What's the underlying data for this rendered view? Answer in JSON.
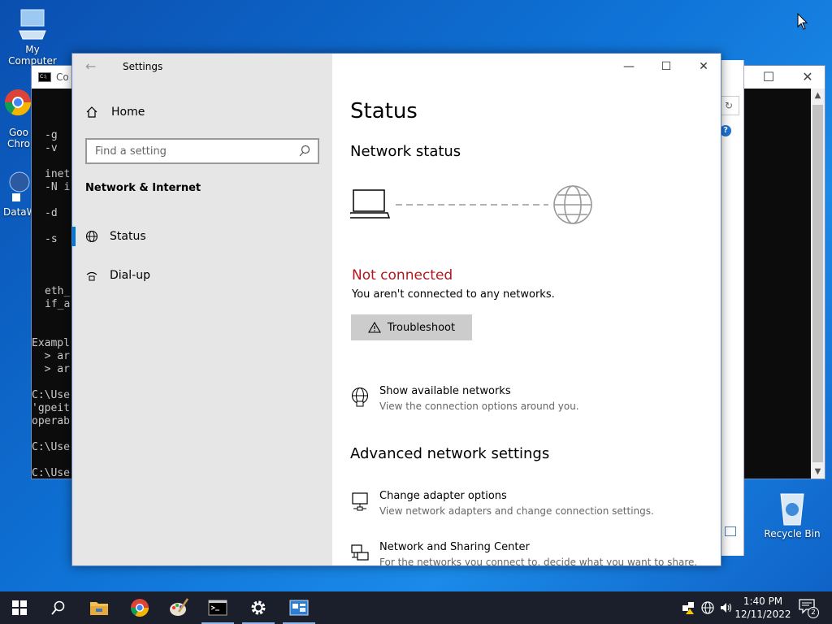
{
  "desktop": {
    "icons": [
      {
        "label": "My Computer"
      },
      {
        "label": "Goo Chro"
      },
      {
        "label": "DataW"
      },
      {
        "label": "Recycle Bin"
      }
    ]
  },
  "cmd": {
    "title": "Co",
    "lines": [
      "-g",
      "-v",
      "inet",
      "-N i",
      "-d",
      "-s",
      "eth_",
      "if_a",
      "Exampl",
      "  > ar",
      "  > ar",
      "C:\\Use",
      "'gpeit",
      "operab",
      "C:\\Use",
      "C:\\Use"
    ]
  },
  "settings": {
    "window_title": "Settings",
    "nav": {
      "home": "Home",
      "search_placeholder": "Find a setting",
      "section": "Network & Internet",
      "items": [
        {
          "label": "Status",
          "icon": "globe-icon",
          "active": true
        },
        {
          "label": "Dial-up",
          "icon": "dialup-icon",
          "active": false
        }
      ]
    },
    "content": {
      "title": "Status",
      "network_status_heading": "Network status",
      "state": "Not connected",
      "state_desc": "You aren't connected to any networks.",
      "troubleshoot": "Troubleshoot",
      "show_networks": {
        "title": "Show available networks",
        "desc": "View the connection options around you."
      },
      "advanced_heading": "Advanced network settings",
      "change_adapter": {
        "title": "Change adapter options",
        "desc": "View network adapters and change connection settings."
      },
      "sharing_center": {
        "title": "Network and Sharing Center",
        "desc": "For the networks you connect to, decide what you want to share."
      }
    },
    "colors": {
      "accent": "#0078d7",
      "error": "#b3171e"
    }
  },
  "taskbar": {
    "apps": [
      "start-icon",
      "search-icon",
      "file-explorer-icon",
      "chrome-icon",
      "paint-icon",
      "cmd-icon",
      "settings-icon",
      "network-app-icon"
    ],
    "clock_time": "1:40 PM",
    "clock_date": "12/11/2022",
    "notification_count": "2"
  }
}
